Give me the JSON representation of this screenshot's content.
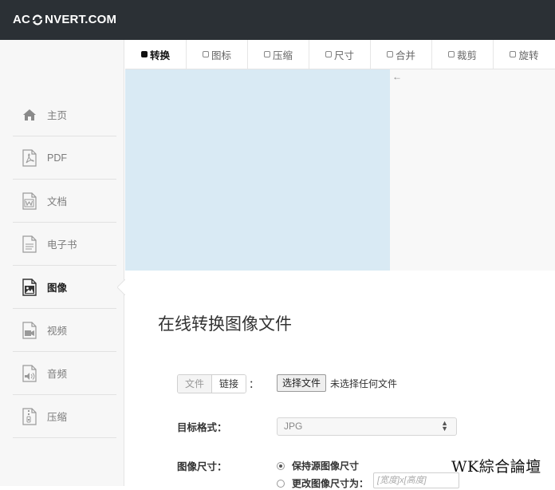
{
  "header": {
    "logo_prefix": "AC",
    "logo_suffix": "NVERT.COM"
  },
  "sidebar": {
    "items": [
      {
        "label": "主页",
        "icon": "home-icon"
      },
      {
        "label": "PDF",
        "icon": "pdf-icon"
      },
      {
        "label": "文档",
        "icon": "word-doc-icon"
      },
      {
        "label": "电子书",
        "icon": "ebook-icon"
      },
      {
        "label": "图像",
        "icon": "image-icon",
        "active": true
      },
      {
        "label": "视频",
        "icon": "video-icon"
      },
      {
        "label": "音频",
        "icon": "audio-icon"
      },
      {
        "label": "压缩",
        "icon": "archive-icon"
      }
    ]
  },
  "tabs": [
    {
      "label": "转换",
      "active": true
    },
    {
      "label": "图标"
    },
    {
      "label": "压缩"
    },
    {
      "label": "尺寸"
    },
    {
      "label": "合并"
    },
    {
      "label": "裁剪"
    },
    {
      "label": "旋转"
    }
  ],
  "banner": {
    "arrow": "←"
  },
  "main": {
    "title": "在线转换图像文件",
    "source": {
      "file_label": "文件",
      "link_label": "链接",
      "colon": "：",
      "choose_button": "选择文件",
      "file_status": "未选择任何文件"
    },
    "target_format": {
      "label": "目标格式：",
      "value": "JPG",
      "caret": "▲▼"
    },
    "image_size": {
      "label": "图像尺寸：",
      "option_keep": "保持源图像尺寸",
      "option_change": "更改图像尺寸为：",
      "input_placeholder": "[宽度]x[高度]"
    }
  },
  "watermark": "WK綜合論壇",
  "colors": {
    "header_bg": "#2b3035",
    "banner_bg": "#d9eaf4",
    "sidebar_bg": "#f7f7f7"
  }
}
